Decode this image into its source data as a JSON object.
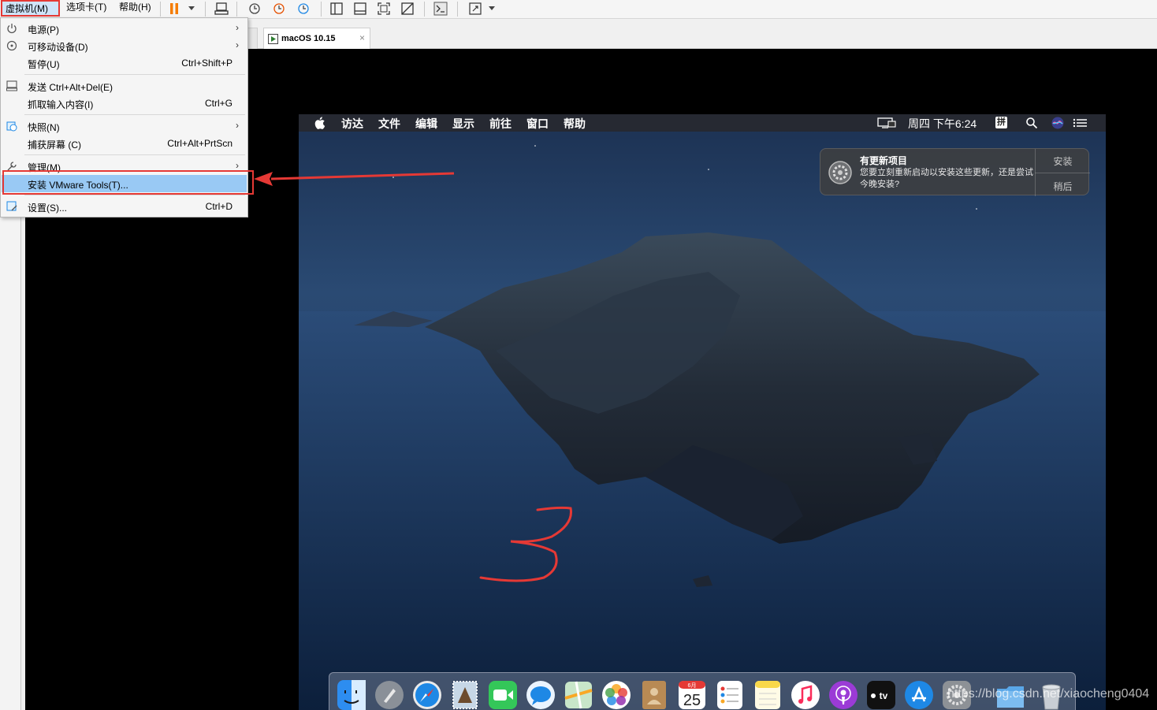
{
  "menubar": {
    "vm": "虚拟机(M)",
    "tabs": "选项卡(T)",
    "help": "帮助(H)"
  },
  "tab": {
    "label": "macOS 10.15",
    "close": "×"
  },
  "vm_menu": {
    "items": [
      {
        "label": "电源(P)",
        "shortcut": "",
        "submenu": "›"
      },
      {
        "label": "可移动设备(D)",
        "shortcut": "",
        "submenu": "›"
      },
      {
        "label": "暂停(U)",
        "shortcut": "Ctrl+Shift+P",
        "submenu": ""
      },
      {
        "label": "发送 Ctrl+Alt+Del(E)",
        "shortcut": "",
        "submenu": ""
      },
      {
        "label": "抓取输入内容(I)",
        "shortcut": "Ctrl+G",
        "submenu": ""
      },
      {
        "label": "快照(N)",
        "shortcut": "",
        "submenu": "›"
      },
      {
        "label": "捕获屏幕 (C)",
        "shortcut": "Ctrl+Alt+PrtScn",
        "submenu": ""
      },
      {
        "label": "管理(M)",
        "shortcut": "",
        "submenu": "›"
      },
      {
        "label": "安装 VMware Tools(T)...",
        "shortcut": "",
        "submenu": ""
      },
      {
        "label": "设置(S)...",
        "shortcut": "Ctrl+D",
        "submenu": ""
      }
    ]
  },
  "macos": {
    "menus": [
      "访达",
      "文件",
      "编辑",
      "显示",
      "前往",
      "窗口",
      "帮助"
    ],
    "clock": "周四 下午6:24",
    "input_method": "拼",
    "notification": {
      "title": "有更新项目",
      "body": "您要立刻重新启动以安装这些更新，还是尝试今晚安装?",
      "install": "安装",
      "later": "稍后"
    },
    "calendar_month": "6月",
    "calendar_day": "25",
    "tv_label": "tv"
  },
  "annotation": {
    "step": "3"
  },
  "watermark": "https://blog.csdn.net/xiaocheng0404",
  "colors": {
    "highlight_red": "#e53935",
    "menu_selected": "#99c9f4"
  }
}
